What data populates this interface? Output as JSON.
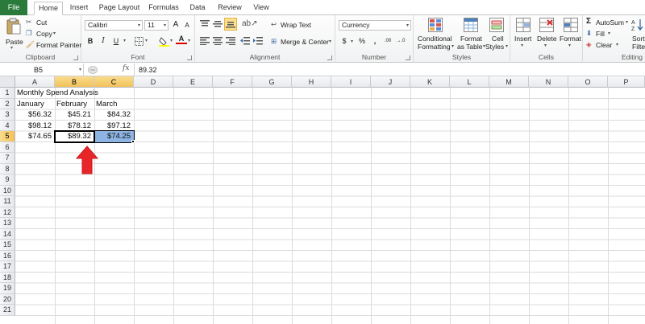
{
  "tabs": [
    {
      "label": "File"
    },
    {
      "label": "Home"
    },
    {
      "label": "Insert"
    },
    {
      "label": "Page Layout"
    },
    {
      "label": "Formulas"
    },
    {
      "label": "Data"
    },
    {
      "label": "Review"
    },
    {
      "label": "View"
    }
  ],
  "ribbon": {
    "clipboard": {
      "paste": "Paste",
      "cut": "Cut",
      "copy": "Copy",
      "format_painter": "Format Painter",
      "label": "Clipboard"
    },
    "font": {
      "name": "Calibri",
      "size": "11",
      "bold": "B",
      "italic": "I",
      "underline": "U",
      "grow": "A",
      "shrink": "A",
      "font_color": "A",
      "label": "Font"
    },
    "alignment": {
      "wrap_text": "Wrap Text",
      "merge_center": "Merge & Center",
      "label": "Alignment"
    },
    "number": {
      "format": "Currency",
      "currency": "$",
      "percent": "%",
      "comma": ",",
      "inc_decimal": ".00",
      "label": "Number"
    },
    "styles": {
      "conditional_1": "Conditional",
      "conditional_2": "Formatting",
      "format_table_1": "Format",
      "format_table_2": "as Table",
      "cell_styles_1": "Cell",
      "cell_styles_2": "Styles",
      "label": "Styles"
    },
    "cells": {
      "insert": "Insert",
      "delete": "Delete",
      "format": "Format",
      "label": "Cells"
    },
    "editing": {
      "autosum": "AutoSum",
      "fill": "Fill",
      "clear": "Clear",
      "sort_1": "Sort",
      "sort_2": "Filter",
      "label": "Editing"
    }
  },
  "formula_bar": {
    "name_box": "B5",
    "fx": "fx",
    "value": "89.32"
  },
  "columns": [
    "A",
    "B",
    "C",
    "D",
    "E",
    "F",
    "G",
    "H",
    "I",
    "J",
    "K",
    "L",
    "M",
    "N",
    "O",
    "P"
  ],
  "rows": [
    "1",
    "2",
    "3",
    "4",
    "5",
    "6",
    "7",
    "8",
    "9",
    "10",
    "11",
    "12",
    "13",
    "14",
    "15",
    "16",
    "17",
    "18",
    "19",
    "20",
    "21"
  ],
  "sheet": {
    "title": "Monthly Spend Analysis",
    "headers": [
      "January",
      "February",
      "March"
    ],
    "data": [
      [
        "$56.32",
        "$45.21",
        "$84.32"
      ],
      [
        "$98.12",
        "$78.12",
        "$97.12"
      ],
      [
        "$74.65",
        "$89.32",
        "$74.25"
      ]
    ]
  },
  "colors": {
    "file_tab": "#2a7a3b",
    "selection_fill": "#8db4e2",
    "header_highlight": "#f2c25a",
    "arrow": "#e8262a"
  },
  "annotation": {
    "icon": "red-up-arrow-icon"
  }
}
